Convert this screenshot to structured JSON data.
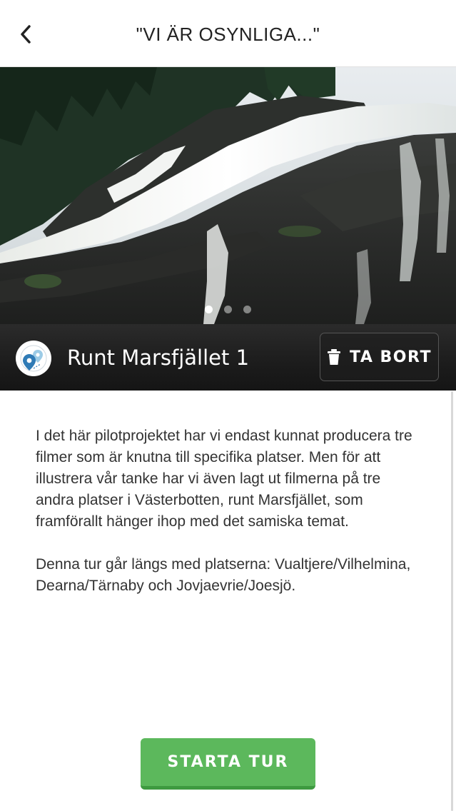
{
  "header": {
    "title": "\"VI ÄR OSYNLIGA...\"",
    "back_icon": "chevron-left-icon"
  },
  "hero": {
    "image_subject": "waterfall over rocks",
    "slides_total": 3,
    "active_slide": 1
  },
  "tour": {
    "title": "Runt Marsfjället 1",
    "logo_icon": "map-pin-icon",
    "remove_label": "TA BORT",
    "remove_icon": "trash-icon"
  },
  "description": {
    "paragraphs": [
      "I det här pilotprojektet har vi endast kunnat producera tre filmer som är knutna till specifika platser. Men för att illustrera vår tanke har vi även lagt ut filmerna på tre andra platser i Västerbotten, runt Marsfjället, som framförallt hänger ihop med det samiska temat.",
      "Denna tur går längs med platserna: Vualtjere/Vilhelmina, Dearna/Tärnaby och Jovjaevrie/Joesjö."
    ]
  },
  "actions": {
    "start_label": "STARTA TUR"
  },
  "colors": {
    "accent_green": "#5cb85c",
    "title_bar": "#1c1c1c",
    "logo_blue": "#2f7bb6"
  }
}
